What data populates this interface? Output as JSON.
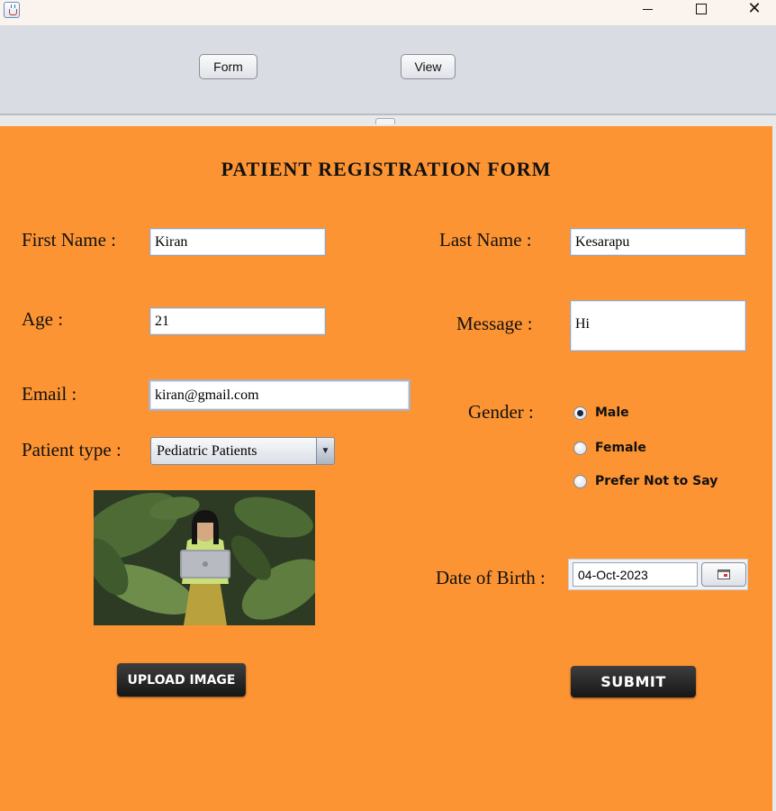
{
  "toolbar": {
    "form_label": "Form",
    "view_label": "View"
  },
  "form": {
    "heading": "PATIENT REGISTRATION FORM",
    "first_name": {
      "label": "First Name :",
      "value": "Kiran"
    },
    "last_name": {
      "label": "Last Name :",
      "value": "Kesarapu"
    },
    "age": {
      "label": "Age :",
      "value": "21"
    },
    "message": {
      "label": "Message :",
      "value": "Hi"
    },
    "email": {
      "label": "Email :",
      "value": "kiran@gmail.com"
    },
    "gender": {
      "label": "Gender :",
      "options": [
        {
          "label": "Male",
          "selected": true
        },
        {
          "label": "Female",
          "selected": false
        },
        {
          "label": "Prefer Not to Say",
          "selected": false
        }
      ]
    },
    "patient_type": {
      "label": "Patient type :",
      "value": "Pediatric Patients"
    },
    "dob": {
      "label": "Date of Birth :",
      "value": "04-Oct-2023"
    },
    "upload_label": "UPLOAD IMAGE",
    "submit_label": "SUBMIT"
  },
  "colors": {
    "panel": "#fd9433",
    "toolbar": "#d9dce2",
    "button_dark": "#1e1e1e"
  },
  "icons": [
    "java-app-icon",
    "minimize-icon",
    "maximize-icon",
    "close-icon",
    "chevron-down-icon",
    "calendar-icon"
  ]
}
